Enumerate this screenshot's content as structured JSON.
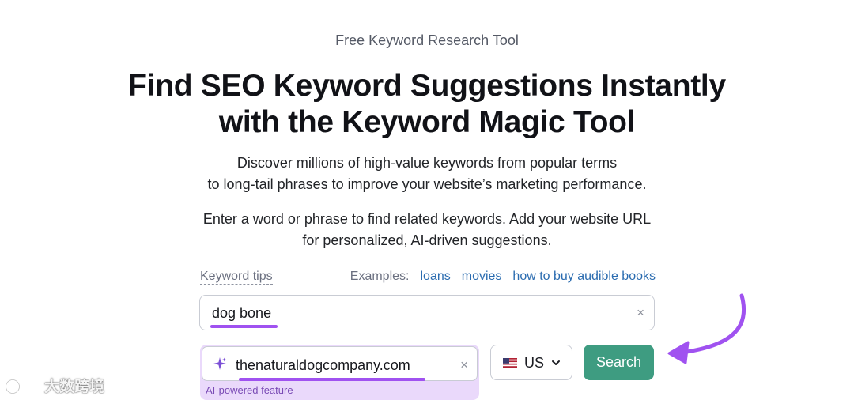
{
  "header": {
    "eyebrow": "Free Keyword Research Tool",
    "title_line1": "Find SEO Keyword Suggestions Instantly",
    "title_line2": "with the Keyword Magic Tool",
    "description_line1": "Discover millions of high-value keywords from popular terms",
    "description_line2": "to long-tail phrases to improve your website’s marketing performance.",
    "instruction_line1": "Enter a word or phrase to find related keywords. Add your website URL",
    "instruction_line2": "for personalized, AI-driven suggestions."
  },
  "tips": {
    "label": "Keyword tips",
    "examples_label": "Examples:",
    "examples": [
      "loans",
      "movies",
      "how to buy audible books"
    ]
  },
  "keyword_input": {
    "value": "dog bone",
    "clear_icon": "×"
  },
  "url_input": {
    "icon": "sparkle-icon",
    "value": "thenaturaldogcompany.com",
    "clear_icon": "×",
    "badge": "AI-powered feature"
  },
  "country_select": {
    "flag_icon": "us-flag-icon",
    "selected": "US",
    "chevron_icon": "chevron-down-icon"
  },
  "search_button": {
    "label": "Search"
  },
  "annotations": {
    "underline_color": "#a052f0",
    "arrow_icon": "curved-arrow-icon"
  },
  "watermark": {
    "text": "大数跨境"
  },
  "colors": {
    "accent_green": "#3e9c81",
    "ai_purple_bg": "#ead9fb",
    "link_blue": "#2b6cb0"
  }
}
